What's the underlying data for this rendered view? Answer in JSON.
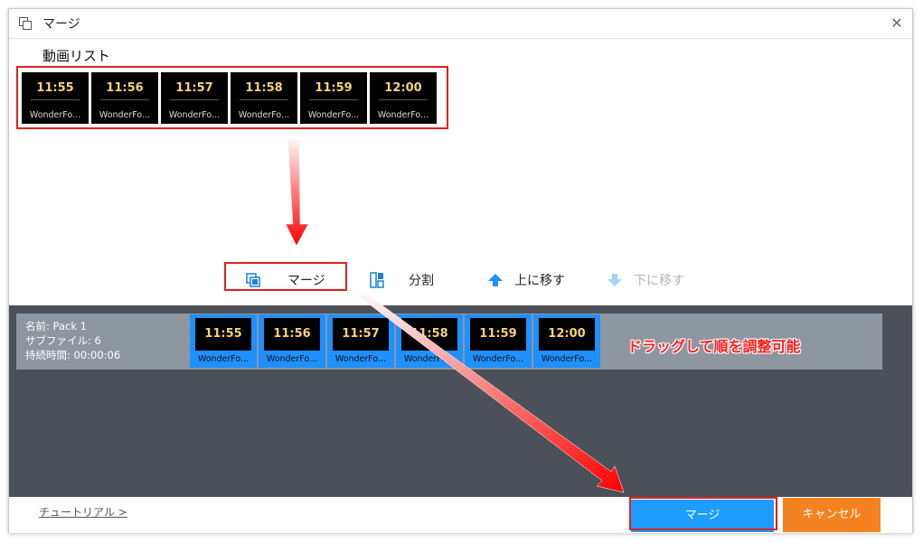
{
  "window": {
    "title": "マージ"
  },
  "video_list": {
    "label": "動画リスト",
    "items": [
      {
        "time": "11:55",
        "name": "WonderFo..."
      },
      {
        "time": "11:56",
        "name": "WonderFo..."
      },
      {
        "time": "11:57",
        "name": "WonderFo..."
      },
      {
        "time": "11:58",
        "name": "WonderFo..."
      },
      {
        "time": "11:59",
        "name": "WonderFo..."
      },
      {
        "time": "12:00",
        "name": "WonderFo..."
      }
    ]
  },
  "toolbar": {
    "merge": "マージ",
    "split": "分割",
    "move_up": "上に移す",
    "move_down": "下に移す"
  },
  "pack": {
    "name": "名前: Pack 1",
    "subfiles": "サブファイル: 6",
    "duration": "持続時間: 00:00:06",
    "items": [
      {
        "time": "11:55",
        "name": "WonderFo..."
      },
      {
        "time": "11:56",
        "name": "WonderFo..."
      },
      {
        "time": "11:57",
        "name": "WonderFo..."
      },
      {
        "time": "11:58",
        "name": "WonderFo..."
      },
      {
        "time": "11:59",
        "name": "WonderFo..."
      },
      {
        "time": "12:00",
        "name": "WonderFo..."
      }
    ]
  },
  "annotation": "ドラッグして順を調整可能",
  "footer": {
    "tutorial": "チュートリアル >",
    "merge_button": "マージ",
    "cancel_button": "キャンセル"
  },
  "colors": {
    "accent_blue": "#1e9cff",
    "cancel_orange": "#f58220",
    "highlight_red": "#e02020",
    "dark_panel": "#4c5159"
  }
}
